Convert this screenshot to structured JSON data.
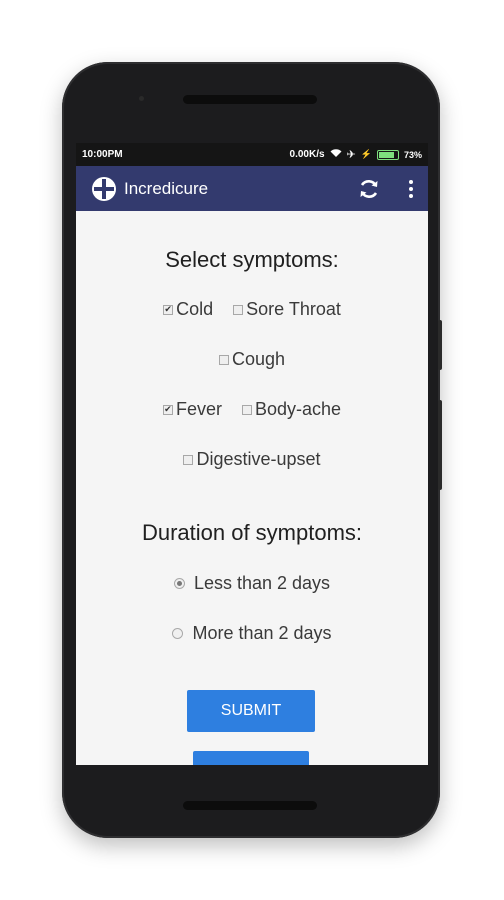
{
  "status_bar": {
    "time": "10:00PM",
    "speed": "0.00K/s",
    "battery": "73%",
    "battery_level": 0.73
  },
  "app_bar": {
    "title": "Incredicure",
    "icons": [
      "app-logo-icon",
      "refresh-icon",
      "overflow-menu-icon"
    ]
  },
  "symptoms": {
    "heading": "Select symptoms:",
    "items": [
      {
        "label": "Cold",
        "checked": true
      },
      {
        "label": "Sore Throat",
        "checked": false
      },
      {
        "label": "Cough",
        "checked": false
      },
      {
        "label": "Fever",
        "checked": true
      },
      {
        "label": "Body-ache",
        "checked": false
      },
      {
        "label": "Digestive-upset",
        "checked": false
      }
    ]
  },
  "duration": {
    "heading": "Duration of symptoms:",
    "options": [
      {
        "label": "Less than 2 days",
        "selected": true
      },
      {
        "label": "More than 2 days",
        "selected": false
      }
    ]
  },
  "submit_label": "SUBMIT",
  "colors": {
    "app_bar": "#333a6e",
    "button": "#2e7fe0",
    "background": "#f5f5f5"
  }
}
